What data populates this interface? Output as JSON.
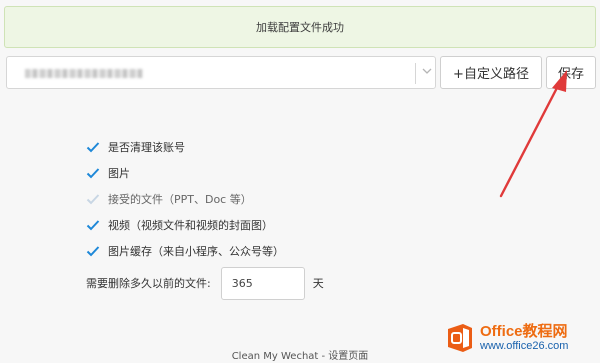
{
  "banner": {
    "text": "加载配置文件成功"
  },
  "toolbar": {
    "path_value": "",
    "custom_path_label": "+自定义路径",
    "save_label": "保存"
  },
  "options": [
    {
      "label": "是否清理该账号",
      "checked": true,
      "disabled": false
    },
    {
      "label": "图片",
      "checked": true,
      "disabled": false
    },
    {
      "label": "接受的文件（PPT、Doc 等）",
      "checked": true,
      "disabled": true
    },
    {
      "label": "视频（视频文件和视频的封面图）",
      "checked": true,
      "disabled": false
    },
    {
      "label": "图片缓存（来自小程序、公众号等）",
      "checked": true,
      "disabled": false
    }
  ],
  "days": {
    "label": "需要删除多久以前的文件:",
    "value": "365",
    "unit": "天"
  },
  "footer": {
    "text": "Clean My Wechat - 设置页面"
  },
  "watermark": {
    "title": "Office教程网",
    "url": "www.office26.com"
  },
  "colors": {
    "check_active": "#1e88d8",
    "check_disabled": "#c8d6e4",
    "arrow": "#e03a3a",
    "banner_bg": "#eef6e4"
  }
}
